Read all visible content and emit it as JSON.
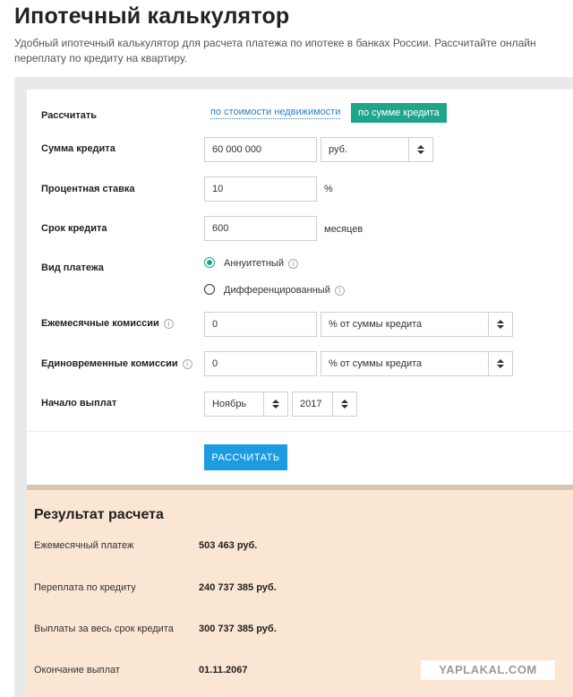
{
  "header": {
    "title": "Ипотечный калькулятор",
    "description": "Удобный ипотечный калькулятор для расчета платежа по ипотеке в банках России. Рассчитайте онлайн переплату по кредиту на квартиру."
  },
  "form": {
    "calc_mode": {
      "label": "Рассчитать",
      "option_property": "по стоимости недвижимости",
      "option_loan": "по сумме кредита"
    },
    "loan_amount": {
      "label": "Сумма кредита",
      "value": "60 000 000",
      "currency": "руб."
    },
    "rate": {
      "label": "Процентная ставка",
      "value": "10",
      "unit": "%"
    },
    "term": {
      "label": "Срок кредита",
      "value": "600",
      "unit": "месяцев"
    },
    "payment_type": {
      "label": "Вид платежа",
      "annuity": "Аннуитетный",
      "differentiated": "Дифференцированный"
    },
    "monthly_fees": {
      "label": "Ежемесячные комиссии",
      "value": "0",
      "type": "% от суммы кредита"
    },
    "onetime_fees": {
      "label": "Единовременные комиссии",
      "value": "0",
      "type": "% от суммы кредита"
    },
    "start": {
      "label": "Начало выплат",
      "month": "Ноябрь",
      "year": "2017"
    },
    "submit_label": "РАССЧИТАТЬ"
  },
  "result": {
    "title": "Результат расчета",
    "rows": [
      {
        "label": "Ежемесячный платеж",
        "value": "503 463 руб."
      },
      {
        "label": "Переплата по кредиту",
        "value": "240 737 385 руб."
      },
      {
        "label": "Выплаты за весь срок кредита",
        "value": "300 737 385 руб."
      },
      {
        "label": "Окончание выплат",
        "value": "01.11.2067"
      }
    ]
  },
  "watermark": "YAPLAKAL.COM",
  "colors": {
    "accent_green": "#1fa58a",
    "button_blue": "#1b9be0",
    "link_blue": "#2f80c9",
    "result_bg": "#fbe5d3"
  }
}
